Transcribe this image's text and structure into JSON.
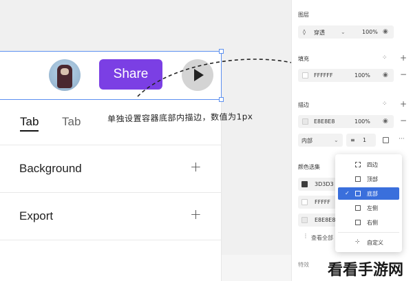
{
  "canvas": {
    "tabs": [
      "Tab",
      "Tab"
    ],
    "rows": [
      {
        "label": "Background",
        "action": "+"
      },
      {
        "label": "Export",
        "action": "+"
      }
    ],
    "share_label": "Share",
    "annotation": "单独设置容器底部内描边，数值为1px"
  },
  "panel": {
    "layer": {
      "title": "图层",
      "blend_mode": "穿透",
      "opacity": "100%"
    },
    "fill": {
      "title": "填充",
      "color": "FFFFFF",
      "opacity": "100%"
    },
    "stroke": {
      "title": "描边",
      "color": "E8E8E8",
      "opacity": "100%",
      "position": "内部",
      "width": "1"
    },
    "color_selection": {
      "title": "颜色选集",
      "items": [
        "3D3D3",
        "FFFFF",
        "E8E8E8"
      ],
      "swatch_colors": [
        "#3D3D3D",
        "#FFFFFF",
        "#E8E8E8"
      ],
      "view_all": "查看全部"
    },
    "effects_title": "特效"
  },
  "dropdown": {
    "items": [
      {
        "label": "四边",
        "icon": "dashed-square-icon"
      },
      {
        "label": "顶部",
        "icon": "square-icon"
      },
      {
        "label": "底部",
        "icon": "square-icon",
        "selected": true
      },
      {
        "label": "左侧",
        "icon": "square-icon"
      },
      {
        "label": "右侧",
        "icon": "square-icon"
      },
      {
        "label": "自定义",
        "icon": "custom-border-icon"
      }
    ]
  },
  "watermark": "看看手游网",
  "colors": {
    "accent": "#7B3FE4",
    "selection": "#5B8FF0",
    "dropdown_selected": "#3A6FDC"
  }
}
